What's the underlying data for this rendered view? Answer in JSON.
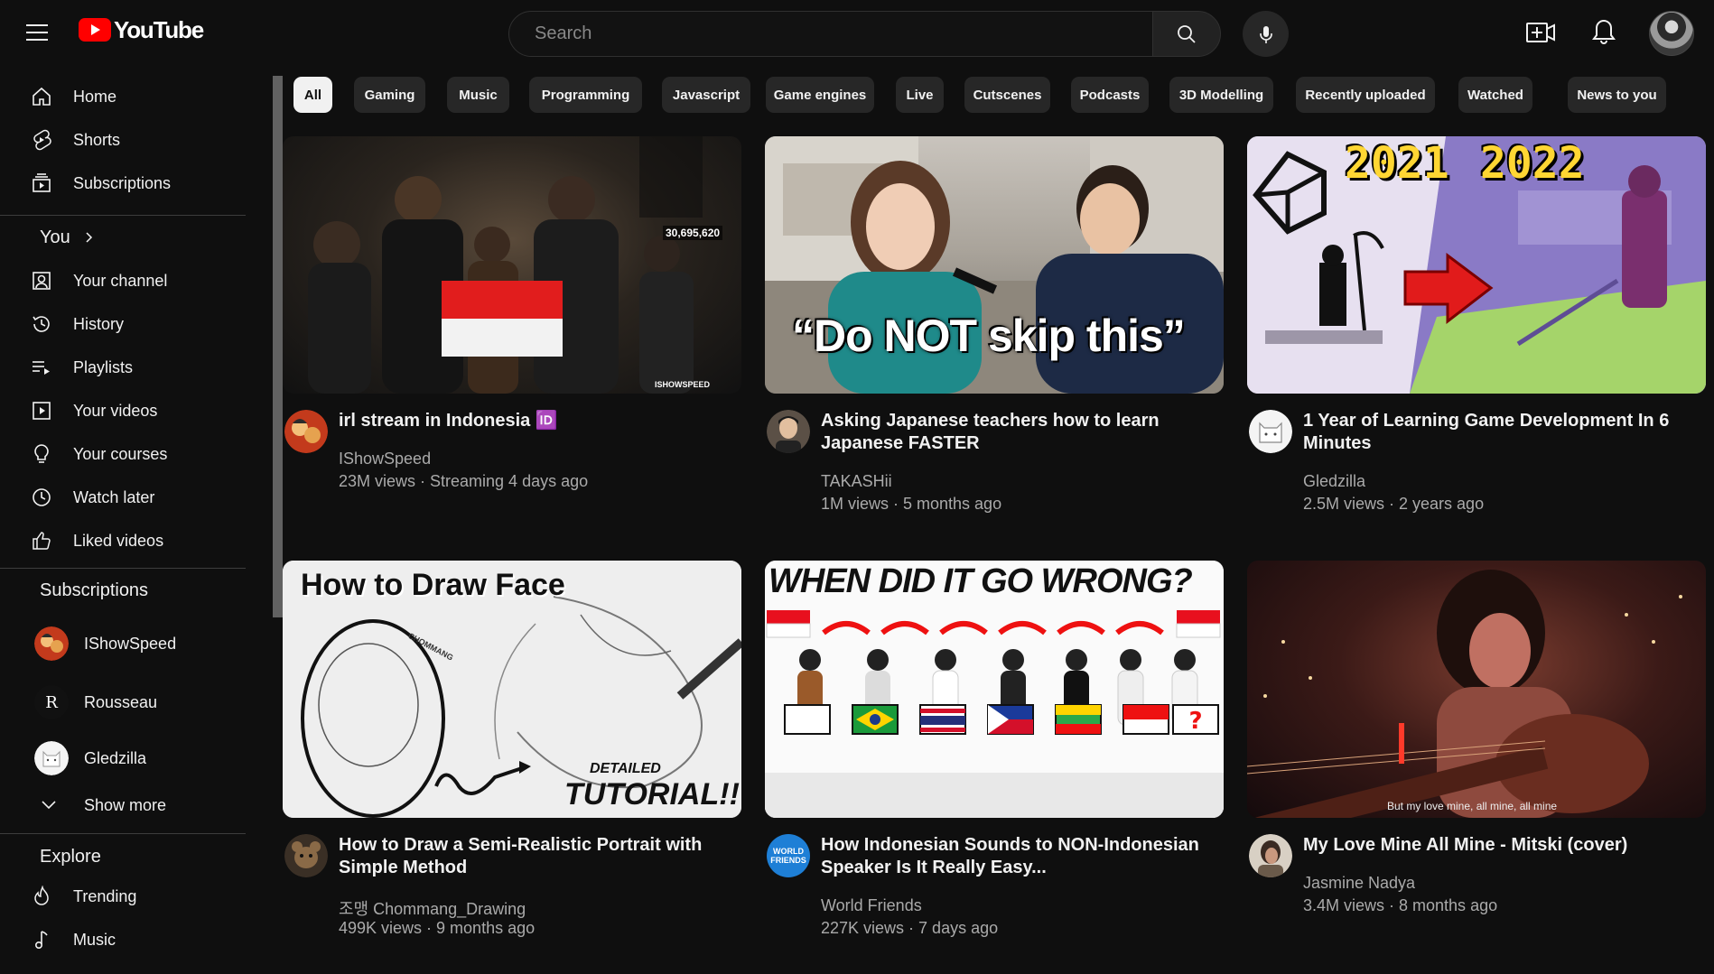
{
  "header": {
    "logo_text": "YouTube",
    "search_placeholder": "Search"
  },
  "sidebar": {
    "main": [
      {
        "label": "Home",
        "icon": "home-icon"
      },
      {
        "label": "Shorts",
        "icon": "shorts-icon"
      },
      {
        "label": "Subscriptions",
        "icon": "subscriptions-icon"
      }
    ],
    "you_label": "You",
    "you_items": [
      {
        "label": "Your channel",
        "icon": "your-channel-icon"
      },
      {
        "label": "History",
        "icon": "history-icon"
      },
      {
        "label": "Playlists",
        "icon": "playlists-icon"
      },
      {
        "label": "Your videos",
        "icon": "your-videos-icon"
      },
      {
        "label": "Your courses",
        "icon": "courses-icon"
      },
      {
        "label": "Watch later",
        "icon": "watch-later-icon"
      },
      {
        "label": "Liked videos",
        "icon": "liked-icon"
      }
    ],
    "subscriptions_header": "Subscriptions",
    "subscriptions": [
      {
        "label": "IShowSpeed"
      },
      {
        "label": "Rousseau"
      },
      {
        "label": "Gledzilla"
      }
    ],
    "show_more": "Show more",
    "explore_header": "Explore",
    "explore_items": [
      {
        "label": "Trending",
        "icon": "trending-icon"
      },
      {
        "label": "Music",
        "icon": "music-icon"
      }
    ]
  },
  "chips": [
    "All",
    "Gaming",
    "Music",
    "Programming",
    "Javascript",
    "Game engines",
    "Live",
    "Cutscenes",
    "Podcasts",
    "3D Modelling",
    "Recently uploaded",
    "Watched",
    "News to you"
  ],
  "videos": [
    {
      "title": "irl stream in Indonesia 🆔",
      "channel": "IShowSpeed",
      "meta": "23M views · Streaming 4 days ago",
      "thumb_overlay": "30,695,620",
      "thumb_watermark": "ISHOWSPEED"
    },
    {
      "title": "Asking Japanese teachers how to learn Japanese FASTER",
      "channel": "TAKASHii",
      "meta": "1M views · 5 months ago",
      "thumb_caption": "“Do NOT skip this”"
    },
    {
      "title": "1 Year of Learning Game Development In 6 Minutes",
      "channel": "Gledzilla",
      "meta": "2.5M views · 2 years ago",
      "thumb_year_a": "2021",
      "thumb_year_b": "2022"
    },
    {
      "title": "How to Draw a Semi-Realistic Portrait with Simple Method",
      "channel": "조맹 Chommang_Drawing",
      "meta": "499K views · 9 months ago",
      "thumb_heading": "How to Draw Face",
      "thumb_sub1": "DETAILED",
      "thumb_sub2": "TUTORIAL!!",
      "thumb_sketch_label": "CHOMMANG"
    },
    {
      "title": "How Indonesian Sounds to NON-Indonesian Speaker Is It Really Easy...",
      "channel": "World Friends",
      "meta": "227K views · 7 days ago",
      "thumb_heading": "WHEN DID IT GO WRONG?",
      "avatar_text": "WORLD FRIENDS"
    },
    {
      "title": "My Love Mine All Mine - Mitski (cover)",
      "channel": "Jasmine Nadya",
      "meta": "3.4M views · 8 months ago",
      "thumb_caption": "But my love mine, all mine, all mine"
    }
  ],
  "colors": {
    "background": "#0f0f0f",
    "brand_red": "#ff0000",
    "chip_bg": "#272727",
    "chip_active_bg": "#f1f1f1",
    "secondary_text": "#aaaaaa"
  }
}
